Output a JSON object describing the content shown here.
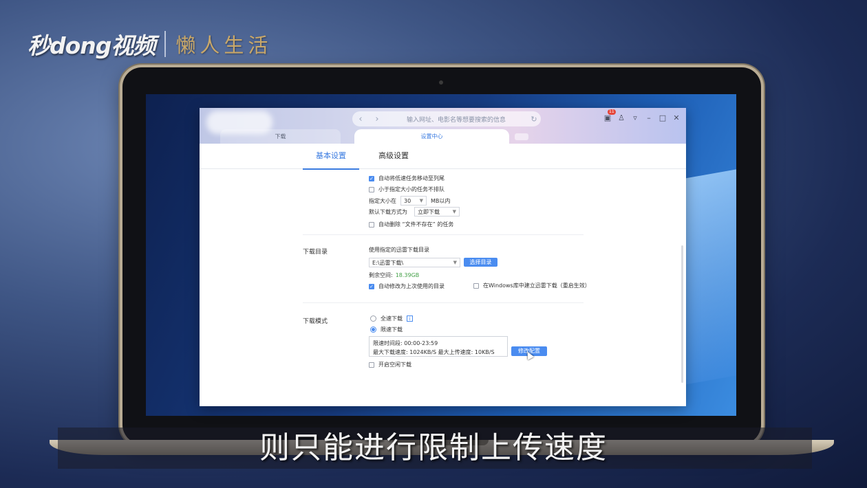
{
  "branding": {
    "logo": "秒dong视频",
    "subbrand": "懒人生活"
  },
  "app": {
    "search_placeholder": "输入网址、电影名等想要搜索的信息",
    "notification_count": "11",
    "tabs": [
      {
        "label": "下载"
      },
      {
        "label": "设置中心"
      }
    ],
    "subtabs": [
      {
        "label": "基本设置"
      },
      {
        "label": "高级设置"
      }
    ],
    "task_settings": {
      "move_slow_tasks": "自动将低速任务移动至列尾",
      "small_tasks_no_queue": "小于指定大小的任务不排队",
      "size_prefix": "指定大小在",
      "size_value": "30",
      "size_suffix": "MB以内",
      "default_mode_label": "默认下载方式为",
      "default_mode_value": "立即下载",
      "auto_delete": "自动删除 “文件不存在” 的任务"
    },
    "download_dir": {
      "section_label": "下载目录",
      "use_dir_label": "使用指定的迅雷下载目录",
      "dir_value": "E:\\迅雷下载\\",
      "choose_button": "选择目录",
      "free_space_label": "剩余空间:",
      "free_space_value": "18.39GB",
      "auto_change_last": "自动修改为上次使用的目录",
      "windows_library": "在Windows库中建立迅雷下载（重启生效）"
    },
    "download_mode": {
      "section_label": "下载模式",
      "full_speed": "全速下载",
      "limited_speed": "限速下载",
      "limit_time": "限速时间段:  00:00-23:59",
      "limit_speeds": "最大下载速度:  1024KB/S  最大上传速度:  10KB/S",
      "modify_button": "修改配置",
      "idle_download": "开启空闲下载"
    }
  },
  "subtitle": "则只能进行限制上传速度"
}
